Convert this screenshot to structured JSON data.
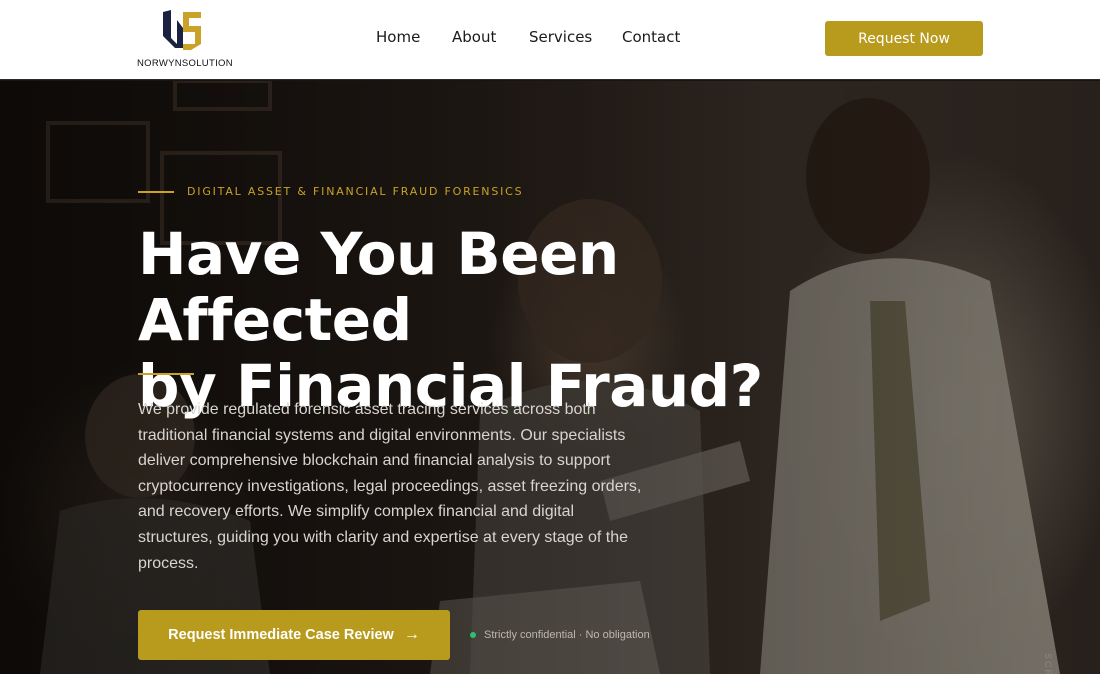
{
  "brand": {
    "name": "NORWYNSOLUTION",
    "colors": {
      "accent": "#b89a1d",
      "accent_light": "#c9a227",
      "logo_dark": "#1b2140",
      "logo_gold": "#c9a227",
      "status_dot": "#2fbf71"
    }
  },
  "nav": {
    "items": [
      {
        "label": "Home"
      },
      {
        "label": "About"
      },
      {
        "label": "Services"
      },
      {
        "label": "Contact"
      }
    ],
    "cta_label": "Request Now"
  },
  "hero": {
    "eyebrow": "DIGITAL ASSET & FINANCIAL FRAUD FORENSICS",
    "headline_line1": "Have You Been Affected",
    "headline_line2": "by Financial Fraud?",
    "body": "We provide regulated forensic asset tracing services across both traditional financial systems and digital environments. Our specialists deliver comprehensive blockchain and financial analysis to support cryptocurrency investigations, legal proceedings, asset freezing orders, and recovery efforts. We simplify complex financial and digital structures, guiding you with clarity and expertise at every stage of the process.",
    "cta_label": "Request Immediate Case Review",
    "cta_icon": "arrow-right-icon",
    "cta_arrow": "→",
    "note": "Strictly confidential · No obligation",
    "scroll_hint": "SCR"
  }
}
